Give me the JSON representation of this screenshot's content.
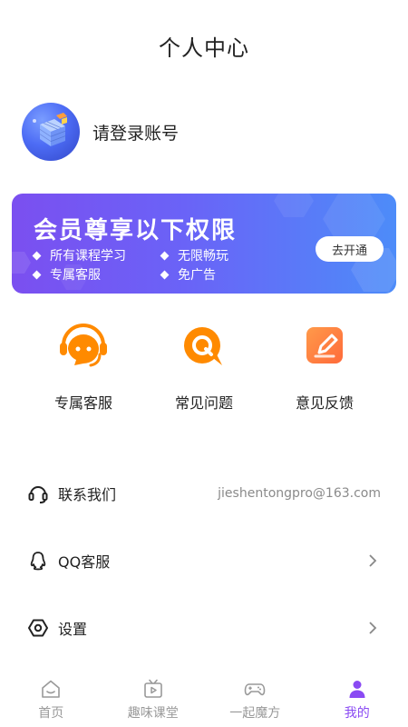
{
  "header": {
    "title": "个人中心"
  },
  "profile": {
    "login_prompt": "请登录账号"
  },
  "vip": {
    "title": "会员尊享以下权限",
    "benefits": [
      "所有课程学习",
      "无限畅玩",
      "专属客服",
      "免广告"
    ],
    "open_label": "去开通"
  },
  "services": [
    {
      "label": "专属客服",
      "icon": "headset-chat-icon",
      "color": "#ff8a00"
    },
    {
      "label": "常见问题",
      "icon": "q-bubble-icon",
      "color": "#ff8a00"
    },
    {
      "label": "意见反馈",
      "icon": "edit-note-icon",
      "color": "#ff7a3d"
    }
  ],
  "list": {
    "contact": {
      "label": "联系我们",
      "value": "jieshentongpro@163.com"
    },
    "qq": {
      "label": "QQ客服"
    },
    "settings": {
      "label": "设置"
    }
  },
  "tabbar": [
    {
      "label": "首页",
      "icon": "home-icon",
      "active": false
    },
    {
      "label": "趣味课堂",
      "icon": "tv-play-icon",
      "active": false
    },
    {
      "label": "一起魔方",
      "icon": "gamepad-icon",
      "active": false
    },
    {
      "label": "我的",
      "icon": "person-icon",
      "active": true
    }
  ],
  "colors": {
    "accent": "#8a4af3",
    "banner_start": "#7b4ff0",
    "banner_end": "#4d8cf9",
    "service_orange": "#ff8a00"
  }
}
